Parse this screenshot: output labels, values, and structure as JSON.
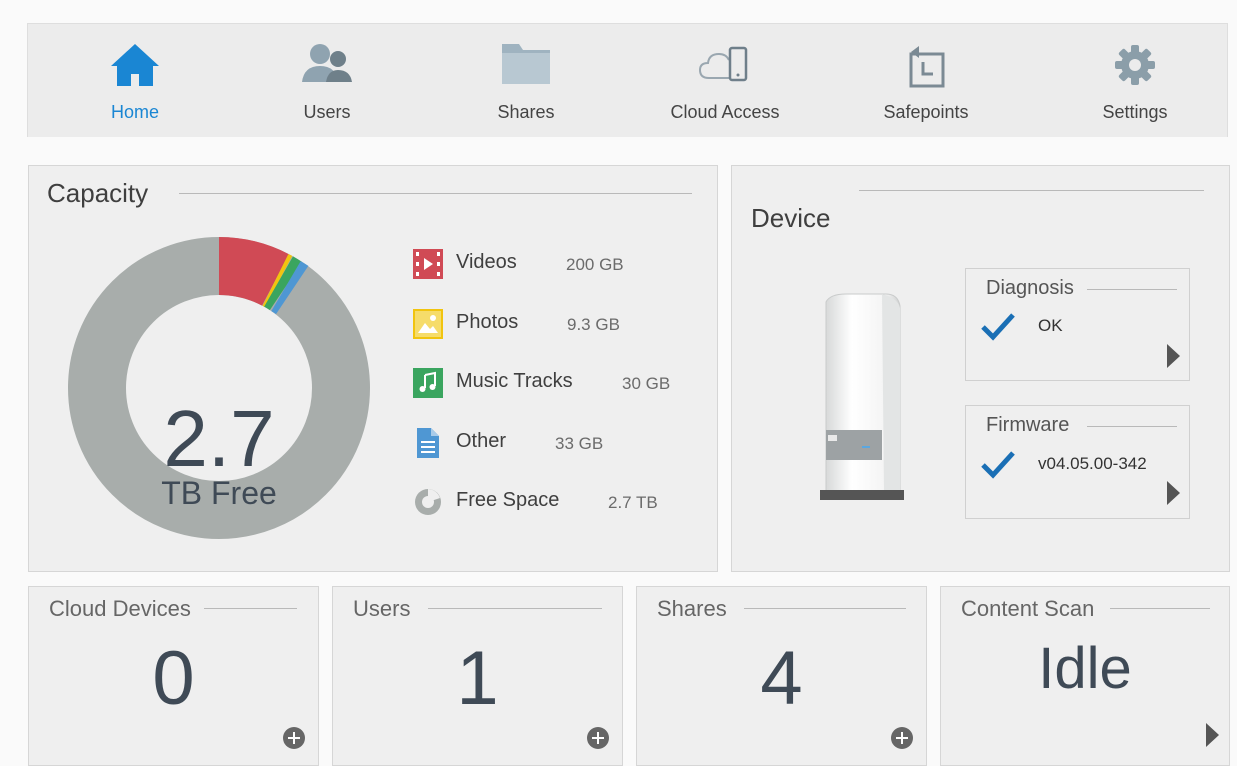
{
  "nav": {
    "items": [
      {
        "label": "Home",
        "icon": "home-icon",
        "active": true
      },
      {
        "label": "Users",
        "icon": "users-icon",
        "active": false
      },
      {
        "label": "Shares",
        "icon": "folder-icon",
        "active": false
      },
      {
        "label": "Cloud Access",
        "icon": "cloud-device-icon",
        "active": false
      },
      {
        "label": "Safepoints",
        "icon": "safepoint-icon",
        "active": false
      },
      {
        "label": "Settings",
        "icon": "gear-icon",
        "active": false
      }
    ],
    "active_color": "#1a86d3"
  },
  "capacity": {
    "title": "Capacity",
    "free_value": "2.7",
    "free_label": "TB Free",
    "legend": [
      {
        "name": "Videos",
        "size": "200 GB",
        "color": "#d04a55",
        "icon": "video-icon"
      },
      {
        "name": "Photos",
        "size": "9.3 GB",
        "color": "#f1c40f",
        "icon": "photo-icon"
      },
      {
        "name": "Music Tracks",
        "size": "30 GB",
        "color": "#3aa55f",
        "icon": "music-icon"
      },
      {
        "name": "Other",
        "size": "33 GB",
        "color": "#4f97d3",
        "icon": "document-icon"
      },
      {
        "name": "Free Space",
        "size": "2.7 TB",
        "color": "#a8adab",
        "icon": "pie-icon"
      }
    ]
  },
  "device": {
    "title": "Device",
    "diagnosis": {
      "title": "Diagnosis",
      "status": "OK"
    },
    "firmware": {
      "title": "Firmware",
      "version": "v04.05.00-342"
    }
  },
  "stats": [
    {
      "title": "Cloud Devices",
      "value": "0",
      "action": "add"
    },
    {
      "title": "Users",
      "value": "1",
      "action": "add"
    },
    {
      "title": "Shares",
      "value": "4",
      "action": "add"
    },
    {
      "title": "Content Scan",
      "value": "Idle",
      "action": "open"
    }
  ],
  "colors": {
    "check": "#1a6fb5",
    "text_dark": "#3f4a56"
  }
}
